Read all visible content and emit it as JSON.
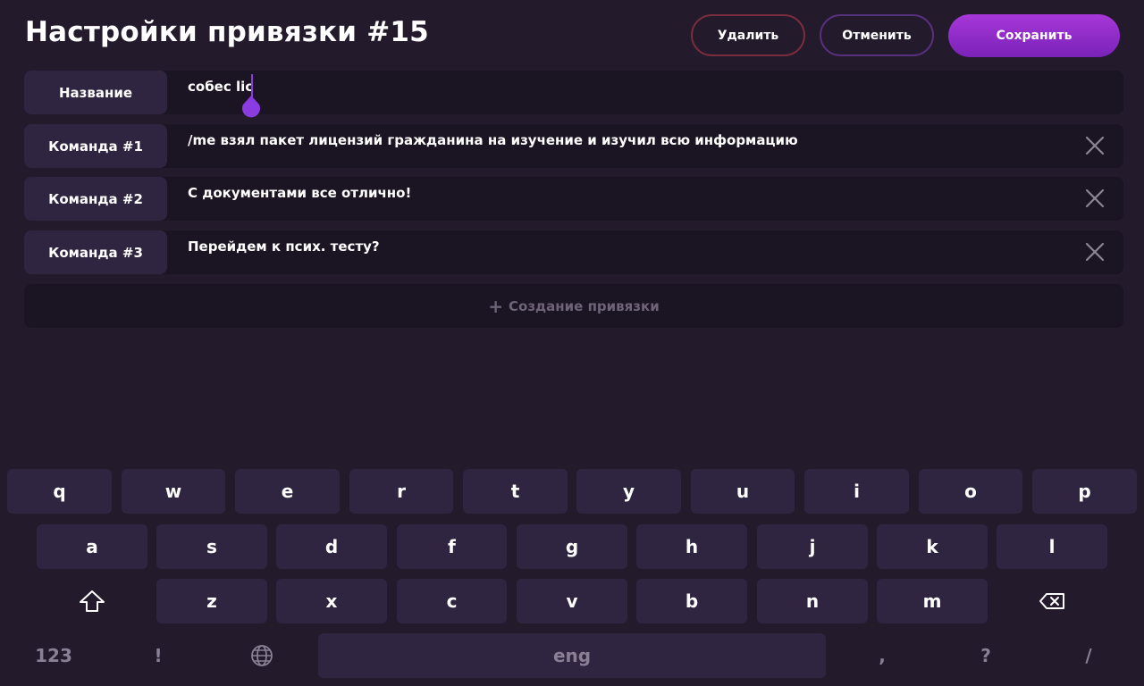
{
  "header": {
    "title": "Настройки привязки #15",
    "delete_label": "Удалить",
    "cancel_label": "Отменить",
    "save_label": "Сохранить"
  },
  "rows": [
    {
      "label": "Название",
      "value": "собес lic"
    },
    {
      "label": "Команда #1",
      "value": "/me взял пакет лицензий гражданина на изучение и изучил всю информацию"
    },
    {
      "label": "Команда #2",
      "value": "С документами все отлично!"
    },
    {
      "label": "Команда #3",
      "value": "Перейдем к псих. тесту?"
    }
  ],
  "create_label": "Создание привязки",
  "keyboard": {
    "row1": [
      "q",
      "w",
      "e",
      "r",
      "t",
      "y",
      "u",
      "i",
      "o",
      "p"
    ],
    "row2": [
      "a",
      "s",
      "d",
      "f",
      "g",
      "h",
      "j",
      "k",
      "l"
    ],
    "row3": [
      "z",
      "x",
      "c",
      "v",
      "b",
      "n",
      "m"
    ],
    "bottom": {
      "numbers": "123",
      "exclaim": "!",
      "space": "eng",
      "comma": ",",
      "question": "?",
      "slash": "/"
    }
  },
  "icons": {
    "close": "close-icon",
    "plus": "plus-icon",
    "shift": "shift-icon",
    "backspace": "backspace-icon",
    "globe": "globe-icon"
  },
  "colors": {
    "background": "#231a2c",
    "accent": "#9b30d9",
    "delete_border": "#7a2d3e",
    "cancel_border": "#58317e",
    "key": "#2f2540"
  }
}
